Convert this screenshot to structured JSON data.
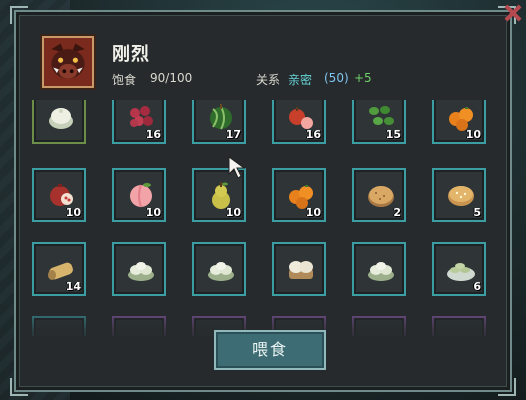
{
  "character": {
    "name": "刚烈",
    "portrait": "boar-portrait-icon",
    "satiety_label": "饱食",
    "satiety_value": "90/100",
    "relation_label": "关系",
    "relation_status": "亲密",
    "relation_value": "(50)",
    "relation_bonus": "+5"
  },
  "items": [
    {
      "icon": "bun-icon",
      "count": "",
      "selected": true
    },
    {
      "icon": "berries-icon",
      "count": "16"
    },
    {
      "icon": "watermelon-icon",
      "count": "17"
    },
    {
      "icon": "apple-peach-icon",
      "count": "16"
    },
    {
      "icon": "green-beans-icon",
      "count": "15"
    },
    {
      "icon": "oranges-icon",
      "count": "10"
    },
    {
      "icon": "pomegranate-icon",
      "count": "10"
    },
    {
      "icon": "peach-icon",
      "count": "10"
    },
    {
      "icon": "pear-icon",
      "count": "10"
    },
    {
      "icon": "oranges-icon",
      "count": "10"
    },
    {
      "icon": "pancake-icon",
      "count": "2"
    },
    {
      "icon": "cookie-icon",
      "count": "5"
    },
    {
      "icon": "roll-icon",
      "count": "14"
    },
    {
      "icon": "dumplings-icon",
      "count": ""
    },
    {
      "icon": "dumplings-icon",
      "count": ""
    },
    {
      "icon": "steamed-buns-icon",
      "count": ""
    },
    {
      "icon": "dumplings-icon",
      "count": ""
    },
    {
      "icon": "dumpling-plate-icon",
      "count": "6"
    },
    {
      "icon": "dish-icon",
      "count": ""
    },
    {
      "icon": "dish-icon",
      "count": "",
      "purple": true
    },
    {
      "icon": "dish-icon",
      "count": "",
      "purple": true
    },
    {
      "icon": "dish-icon",
      "count": "",
      "purple": true
    },
    {
      "icon": "dish-icon",
      "count": "",
      "purple": true
    },
    {
      "icon": "dish-icon",
      "count": "",
      "purple": true
    }
  ],
  "feed_button_label": "喂食",
  "colors": {
    "slot_border": "#3c9ea3",
    "selected_border": "#6d8e48",
    "relation_status": "#66d2d6",
    "relation_bonus": "#6ed06a",
    "button_bg": "#3e6c74"
  }
}
